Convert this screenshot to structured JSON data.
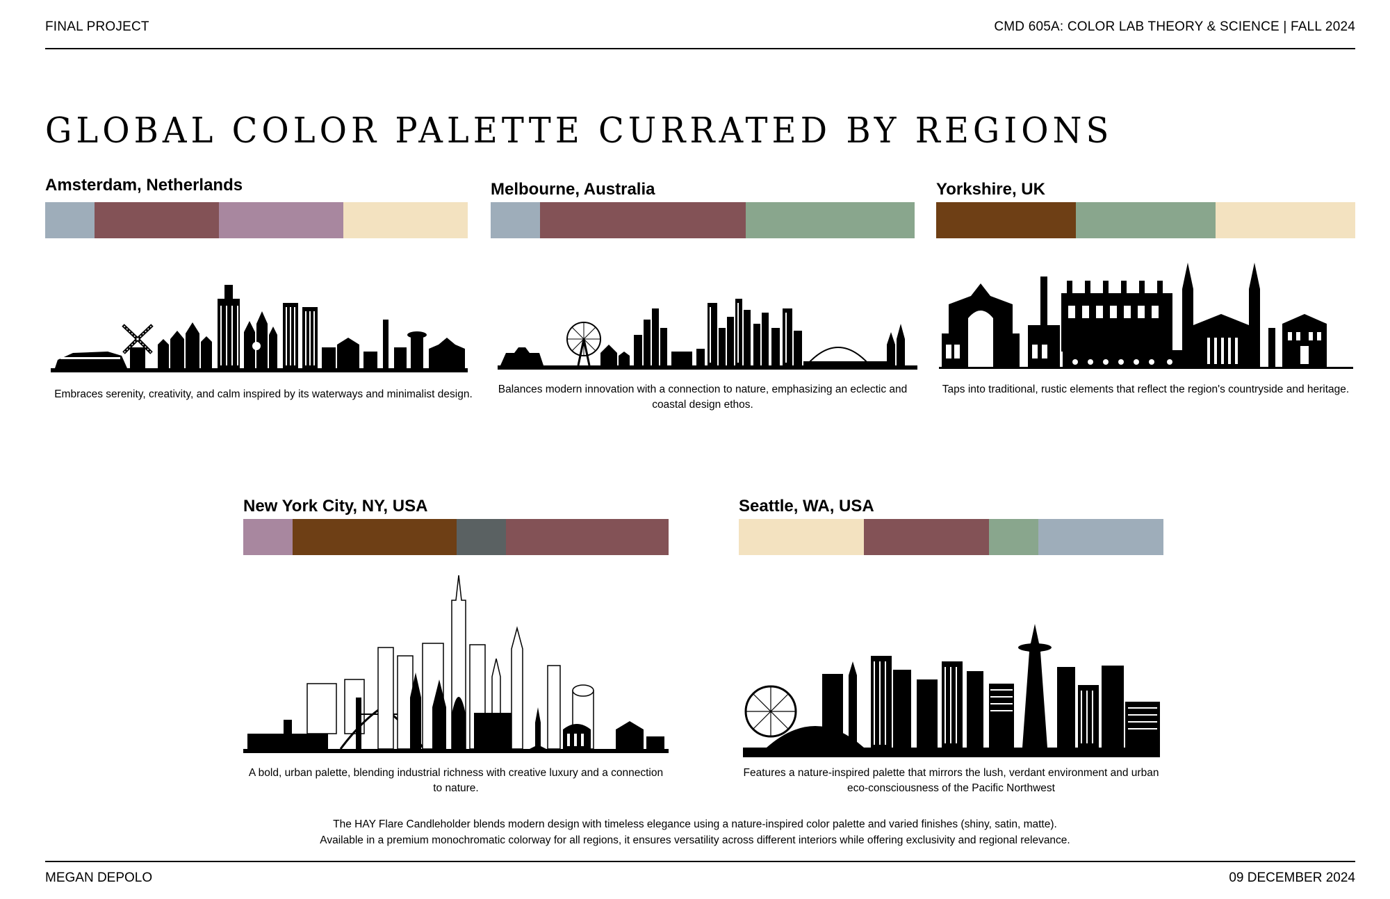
{
  "header": {
    "left": "FINAL PROJECT",
    "right": "CMD 605A: COLOR LAB THEORY & SCIENCE | FALL 2024"
  },
  "title": "GLOBAL COLOR PALETTE CURRATED BY REGIONS",
  "colors": {
    "slate_blue": "#9eadba",
    "mauve_wine": "#835256",
    "lilac": "#a8879f",
    "cream": "#f3e2c0",
    "sage": "#89a68d",
    "brown": "#6e3f15",
    "charcoal": "#5a6162"
  },
  "regions": [
    {
      "name": "Amsterdam, Netherlands",
      "palette": [
        {
          "color": "#9eadba",
          "share": 0.116
        },
        {
          "color": "#835256",
          "share": 0.295
        },
        {
          "color": "#a8879f",
          "share": 0.295
        },
        {
          "color": "#f3e2c0",
          "share": 0.294
        }
      ],
      "skyline_icon": "amsterdam-skyline-icon",
      "description": "Embraces serenity, creativity, and calm inspired by its waterways and minimalist design."
    },
    {
      "name": "Melbourne, Australia",
      "palette": [
        {
          "color": "#9eadba",
          "share": 0.116
        },
        {
          "color": "#835256",
          "share": 0.486
        },
        {
          "color": "#89a68d",
          "share": 0.398
        }
      ],
      "skyline_icon": "melbourne-skyline-icon",
      "description": "Balances modern innovation with a connection to nature, emphasizing an eclectic and coastal design ethos."
    },
    {
      "name": "Yorkshire, UK",
      "palette": [
        {
          "color": "#6e3f15",
          "share": 0.334
        },
        {
          "color": "#89a68d",
          "share": 0.333
        },
        {
          "color": "#f3e2c0",
          "share": 0.333
        }
      ],
      "skyline_icon": "yorkshire-skyline-icon",
      "description": "Taps into traditional, rustic elements that reflect the region's countryside and heritage."
    },
    {
      "name": "New York City, NY, USA",
      "palette": [
        {
          "color": "#a8879f",
          "share": 0.116
        },
        {
          "color": "#6e3f15",
          "share": 0.385
        },
        {
          "color": "#5a6162",
          "share": 0.116
        },
        {
          "color": "#835256",
          "share": 0.383
        }
      ],
      "skyline_icon": "new-york-skyline-icon",
      "description": "A bold, urban palette, blending industrial richness with creative luxury and a connection to nature."
    },
    {
      "name": "Seattle, WA, USA",
      "palette": [
        {
          "color": "#f3e2c0",
          "share": 0.295
        },
        {
          "color": "#835256",
          "share": 0.295
        },
        {
          "color": "#89a68d",
          "share": 0.116
        },
        {
          "color": "#9eadba",
          "share": 0.294
        }
      ],
      "skyline_icon": "seattle-skyline-icon",
      "description": "Features a nature-inspired palette that mirrors the lush, verdant environment and urban eco-consciousness of the Pacific Northwest"
    }
  ],
  "footer_note": {
    "line1": "The HAY Flare Candleholder blends modern design with timeless elegance using a nature-inspired color palette and varied finishes (shiny, satin, matte).",
    "line2": "Available in a premium monochromatic colorway for all regions, it ensures versatility across different interiors while offering exclusivity and regional relevance."
  },
  "footer": {
    "left": "MEGAN DEPOLO",
    "right": "09 DECEMBER 2024"
  }
}
